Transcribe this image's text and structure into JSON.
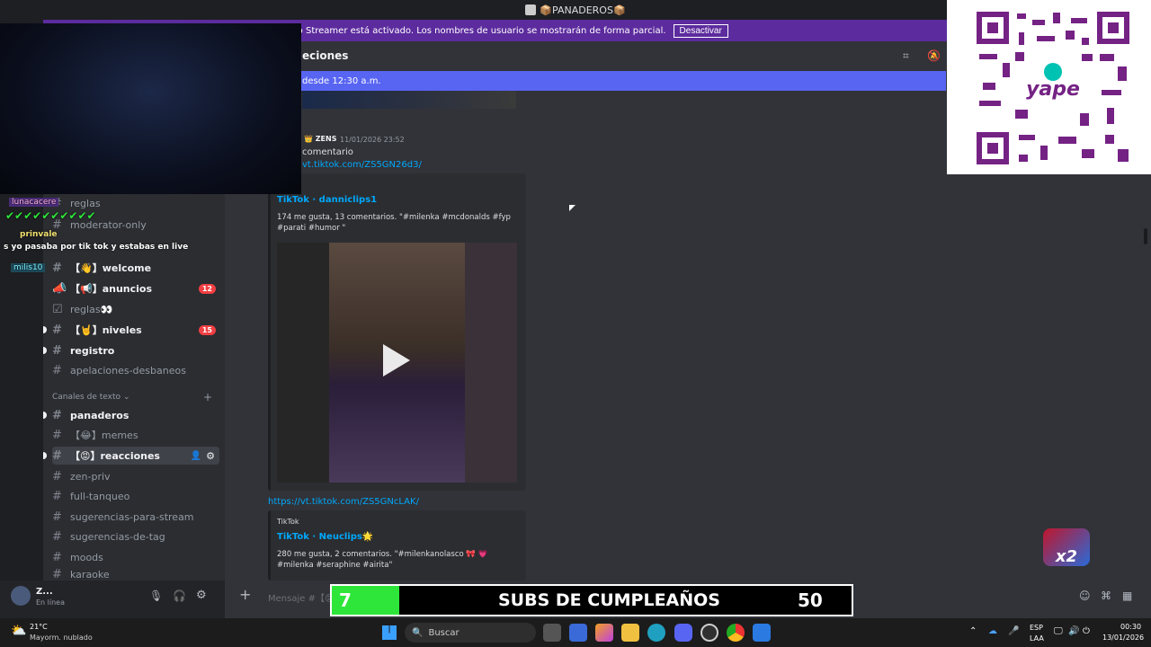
{
  "window": {
    "title": "📦PANADEROS📦"
  },
  "streamer_banner": {
    "text": "El modo Streamer está activado. Los nombres de usuario se mostrarán de forma parcial.",
    "button": "Desactivar"
  },
  "channel_header": {
    "title": "eciones"
  },
  "new_messages_bar": {
    "text": "desde 12:30 a.m."
  },
  "sidebar": {
    "channels": [
      {
        "name": "reglas",
        "label": "reglas"
      },
      {
        "name": "moderator-only",
        "label": "moderator-only"
      },
      {
        "name": "welcome",
        "label": "welcome",
        "prefix": "【👋】"
      },
      {
        "name": "anuncios",
        "label": "anuncios",
        "prefix": "【📢】",
        "badge": "12"
      },
      {
        "name": "reglas2",
        "label": "reglas👀"
      },
      {
        "name": "niveles",
        "label": "niveles",
        "prefix": "【🤘】",
        "badge": "15"
      },
      {
        "name": "registro",
        "label": "registro"
      },
      {
        "name": "apelaciones",
        "label": "apelaciones-desbaneos"
      },
      {
        "name": "panaderos",
        "label": "panaderos"
      },
      {
        "name": "memes",
        "label": "memes",
        "prefix": "【😂】"
      },
      {
        "name": "reacciones",
        "label": "reacciones",
        "prefix": "【😡】"
      },
      {
        "name": "zen-priv",
        "label": "zen-priv"
      },
      {
        "name": "full-tanqueo",
        "label": "full-tanqueo"
      },
      {
        "name": "sugerencias-stream",
        "label": "sugerencias-para-stream"
      },
      {
        "name": "sugerencias-tag",
        "label": "sugerencias-de-tag"
      },
      {
        "name": "moods",
        "label": "moods"
      },
      {
        "name": "karaoke",
        "label": "karaoke"
      }
    ],
    "category_text": "Canales de texto",
    "user": {
      "name": "Z...",
      "status": "En línea"
    }
  },
  "messages": {
    "top": {
      "author": "ZENS",
      "time": "11/01/2026 23:52",
      "text": "comentario",
      "link": "vt.tiktok.com/ZS5GN26d3/"
    },
    "embed1": {
      "title": "TikTok · danniclips1",
      "desc": "174 me gusta, 13 comentarios. \"#milenka #mcdonalds #fyp #parati #humor \""
    },
    "link2": "https://vt.tiktok.com/ZS5GNcLAK/",
    "embed2": {
      "provider": "TikTok",
      "title": "TikTok · Neuclips🌟",
      "desc": "280 me gusta, 2 comentarios. \"#milenkanolasco 🎀 💗 #milenka #seraphine #airita\""
    }
  },
  "message_input": {
    "placeholder": "Mensaje #【😡】"
  },
  "stream_chat": [
    {
      "user": "lunacacere",
      "text": ""
    },
    {
      "user": "prinvale",
      "text": "s yo pasaba por tik tok y estabas en live"
    },
    {
      "user": "milis10",
      "text": ""
    }
  ],
  "overlay": {
    "count": "7",
    "title": "SUBS DE CUMPLEAÑOS",
    "goal": "50",
    "multiplier": "x2"
  },
  "taskbar": {
    "weather_temp": "21°C",
    "weather_desc": "Mayorm. nublado",
    "search": "Buscar",
    "lang1": "ESP",
    "lang2": "LAA",
    "time": "00:30",
    "date": "13/01/2026"
  },
  "colors": {
    "accent": "#5865f2",
    "banner": "#5c2b9e",
    "overlay_green": "#2ee63a"
  }
}
